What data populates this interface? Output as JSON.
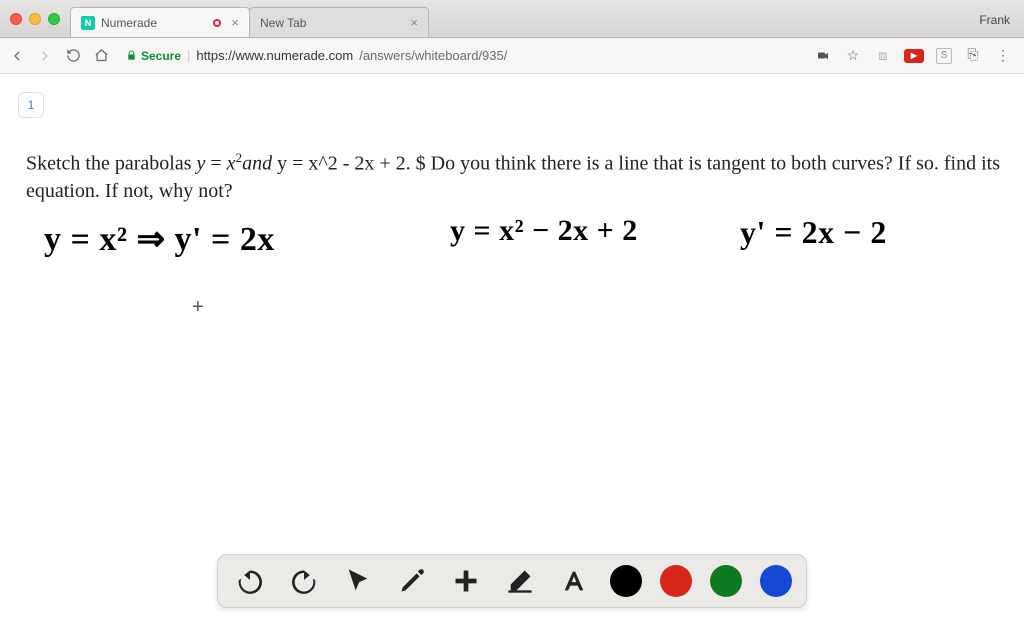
{
  "browser": {
    "profile_name": "Frank",
    "tabs": [
      {
        "title": "Numerade",
        "favicon_letter": "N",
        "recording": true
      },
      {
        "title": "New Tab",
        "favicon_letter": "",
        "recording": false
      }
    ],
    "secure_label": "Secure",
    "url_scheme_host": "https://www.numerade.com",
    "url_path": "/answers/whiteboard/935/"
  },
  "page": {
    "slide_number": "1",
    "question_html": "Sketch the parabolas <i>y</i> = <i>x</i><span class='sup'>2</span><i>and</i> y = x^2 - 2x + 2. $ Do you think there is a line that is tangent to both curves? If so. find its equation. If not, why not?",
    "handwritten": {
      "eq1": "y = x² ⇒ y' = 2x",
      "eq2": "y = x² − 2x + 2",
      "eq3": "y' = 2x − 2"
    }
  },
  "toolbar": {
    "undo": "Undo",
    "redo": "Redo",
    "pointer": "Pointer",
    "pencil": "Pencil",
    "plus": "Add",
    "eraser": "Eraser",
    "text": "Text",
    "colors": {
      "black": "#000000",
      "red": "#d8261c",
      "green": "#0e7a1e",
      "blue": "#1548d5"
    }
  }
}
